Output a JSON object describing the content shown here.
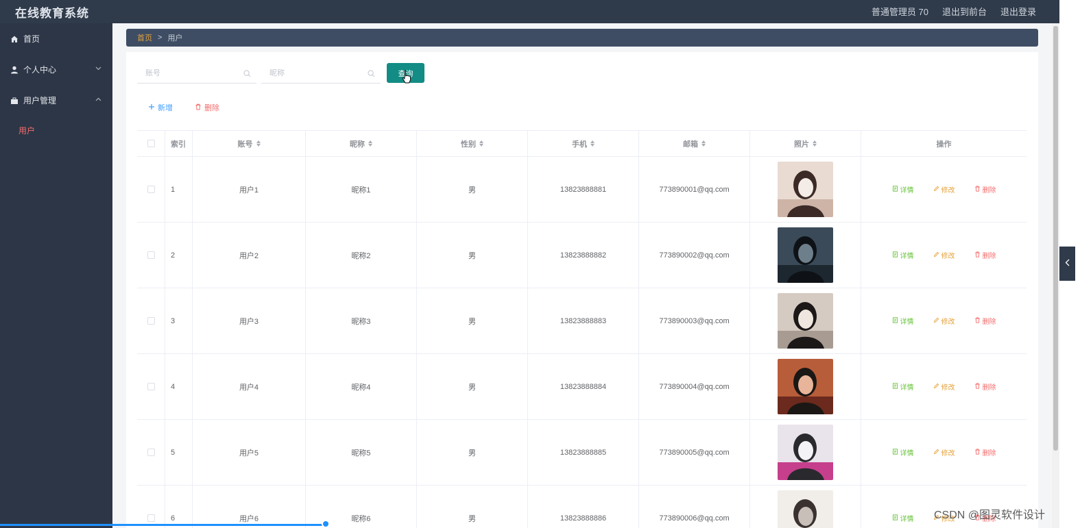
{
  "header": {
    "title": "在线教育系统",
    "user": "普通管理员 70",
    "to_front": "退出到前台",
    "logout": "退出登录"
  },
  "sidebar": {
    "home": "首页",
    "personal": "个人中心",
    "user_mgmt": "用户管理",
    "user_sub": "用户"
  },
  "breadcrumb": {
    "home": "首页",
    "sep": ">",
    "current": "用户"
  },
  "search": {
    "account_placeholder": "账号",
    "nickname_placeholder": "昵称",
    "query_label": "查询"
  },
  "actions": {
    "add_label": "新增",
    "delete_label": "删除"
  },
  "table": {
    "headers": {
      "index": "索引",
      "account": "账号",
      "nickname": "昵称",
      "gender": "性别",
      "phone": "手机",
      "email": "邮箱",
      "photo": "照片",
      "ops": "操作"
    },
    "ops": {
      "detail": "详情",
      "edit": "修改",
      "remove": "删除"
    },
    "rows": [
      {
        "index": "1",
        "account": "用户1",
        "nickname": "昵称1",
        "gender": "男",
        "phone": "13823888881",
        "email": "773890001@qq.com"
      },
      {
        "index": "2",
        "account": "用户2",
        "nickname": "昵称2",
        "gender": "男",
        "phone": "13823888882",
        "email": "773890002@qq.com"
      },
      {
        "index": "3",
        "account": "用户3",
        "nickname": "昵称3",
        "gender": "男",
        "phone": "13823888883",
        "email": "773890003@qq.com"
      },
      {
        "index": "4",
        "account": "用户4",
        "nickname": "昵称4",
        "gender": "男",
        "phone": "13823888884",
        "email": "773890004@qq.com"
      },
      {
        "index": "5",
        "account": "用户5",
        "nickname": "昵称5",
        "gender": "男",
        "phone": "13823888885",
        "email": "773890005@qq.com"
      },
      {
        "index": "6",
        "account": "用户6",
        "nickname": "昵称6",
        "gender": "男",
        "phone": "13823888886",
        "email": "773890006@qq.com"
      }
    ]
  },
  "watermark": "CSDN @图灵软件设计",
  "colors": {
    "sidebar_bg": "#2d3646",
    "header_bg": "#2f3a4a",
    "query_btn": "#128c84",
    "active_menu": "#f56c6c"
  }
}
